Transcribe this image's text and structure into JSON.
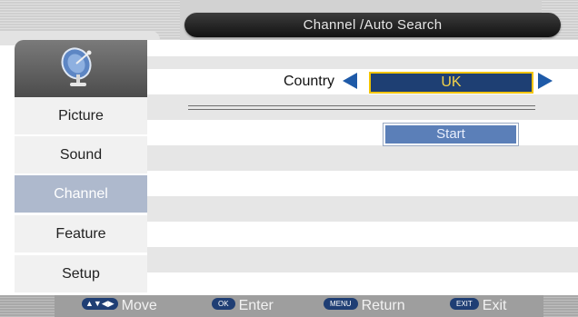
{
  "header": {
    "title": "Channel /Auto Search"
  },
  "sidebar": {
    "icon": "satellite-dish-icon",
    "items": [
      {
        "label": "Picture",
        "active": false
      },
      {
        "label": "Sound",
        "active": false
      },
      {
        "label": "Channel",
        "active": true
      },
      {
        "label": "Feature",
        "active": false
      },
      {
        "label": "Setup",
        "active": false
      }
    ]
  },
  "main": {
    "country_label": "Country",
    "country_value": "UK",
    "start_label": "Start"
  },
  "footer": {
    "hints": [
      {
        "key": "▲▼◀▶",
        "label": "Move"
      },
      {
        "key": "OK",
        "label": "Enter"
      },
      {
        "key": "MENU",
        "label": "Return"
      },
      {
        "key": "EXIT",
        "label": "Exit"
      }
    ]
  },
  "colors": {
    "accent_blue": "#1e3f73",
    "highlight_yellow": "#f2c400",
    "active_menu": "#aeb9cd",
    "title_bar": "#1a1a1a"
  }
}
